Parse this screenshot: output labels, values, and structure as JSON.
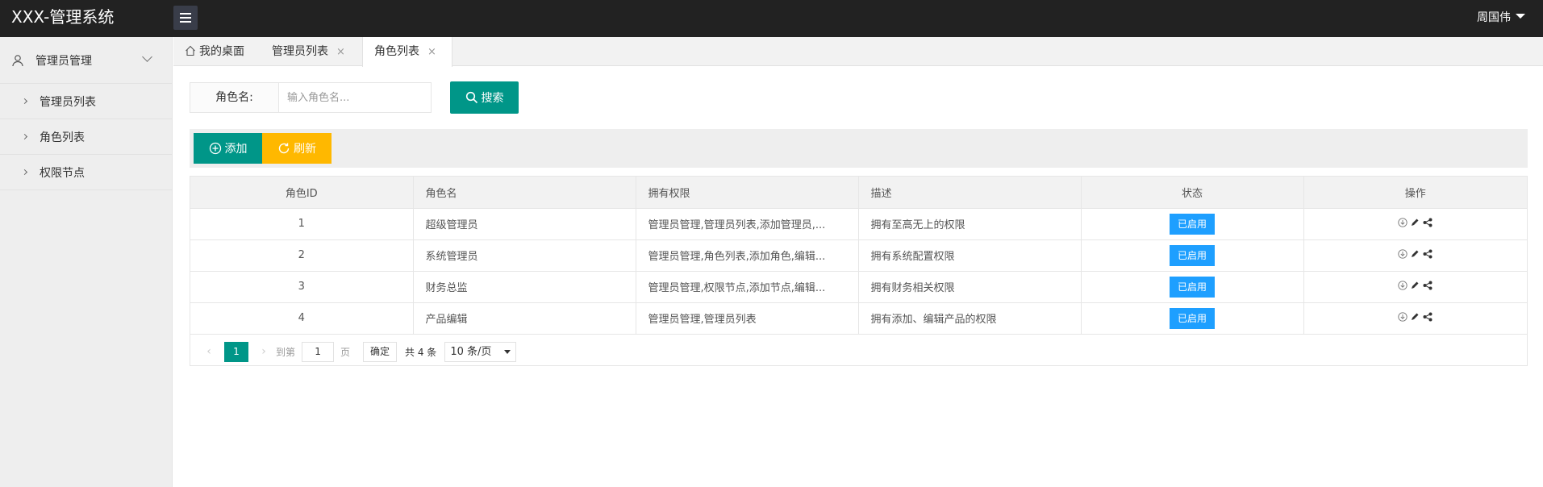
{
  "header": {
    "logo": "XXX-管理系统",
    "user": "周国伟"
  },
  "sidebar": {
    "group": "管理员管理",
    "items": [
      {
        "label": "管理员列表"
      },
      {
        "label": "角色列表"
      },
      {
        "label": "权限节点"
      }
    ]
  },
  "tabs": [
    {
      "label": "我的桌面"
    },
    {
      "label": "管理员列表",
      "close": "×"
    },
    {
      "label": "角色列表",
      "close": "×"
    }
  ],
  "search": {
    "label": "角色名:",
    "placeholder": "输入角色名...",
    "button": "搜索"
  },
  "toolbar": {
    "add": "添加",
    "refresh": "刷新"
  },
  "table": {
    "headers": [
      "角色ID",
      "角色名",
      "拥有权限",
      "描述",
      "状态",
      "操作"
    ],
    "rows": [
      {
        "id": "1",
        "name": "超级管理员",
        "perms": "管理员管理,管理员列表,添加管理员,...",
        "desc": "拥有至高无上的权限",
        "status": "已启用"
      },
      {
        "id": "2",
        "name": "系统管理员",
        "perms": "管理员管理,角色列表,添加角色,编辑...",
        "desc": "拥有系统配置权限",
        "status": "已启用"
      },
      {
        "id": "3",
        "name": "财务总监",
        "perms": "管理员管理,权限节点,添加节点,编辑...",
        "desc": "拥有财务相关权限",
        "status": "已启用"
      },
      {
        "id": "4",
        "name": "产品编辑",
        "perms": "管理员管理,管理员列表",
        "desc": "拥有添加、编辑产品的权限",
        "status": "已启用"
      }
    ]
  },
  "pagination": {
    "prev": "‹",
    "current": "1",
    "next": "›",
    "goto_label": "到第",
    "goto_value": "1",
    "page_label": "页",
    "confirm": "确定",
    "total": "共 4 条",
    "page_size": "10 条/页"
  },
  "colors": {
    "primary": "#009688",
    "warning": "#ffb800",
    "info": "#1e9fff",
    "header_bg": "#222222"
  }
}
